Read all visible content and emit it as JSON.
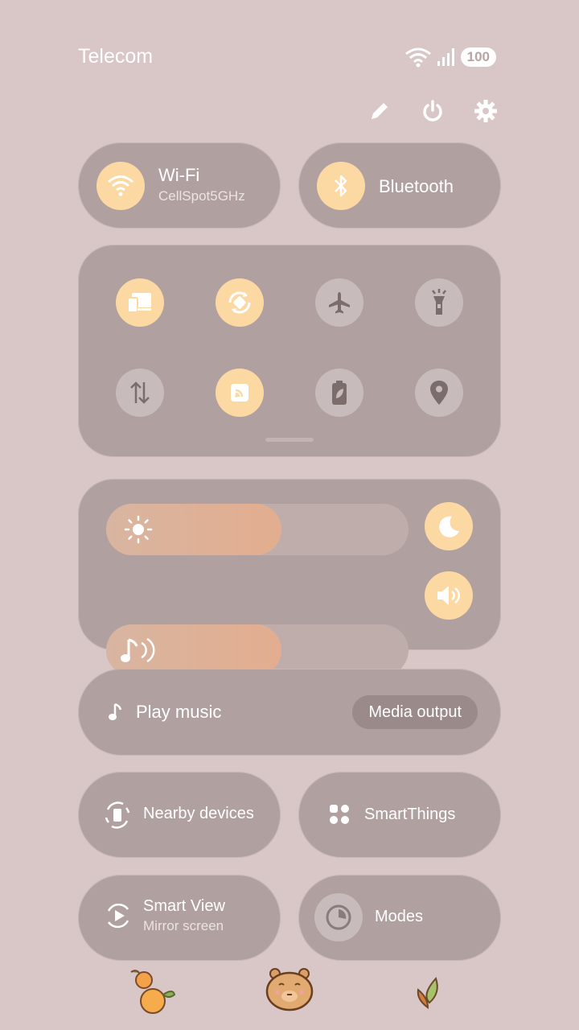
{
  "status": {
    "carrier": "Telecom",
    "battery": "100"
  },
  "wifi": {
    "label": "Wi-Fi",
    "network": "CellSpot5GHz"
  },
  "bluetooth": {
    "label": "Bluetooth"
  },
  "quick_toggles": [
    {
      "name": "screen-cast",
      "on": true
    },
    {
      "name": "auto-rotate",
      "on": true
    },
    {
      "name": "airplane-mode",
      "on": false
    },
    {
      "name": "flashlight",
      "on": false
    },
    {
      "name": "mobile-data",
      "on": false
    },
    {
      "name": "wireless-share",
      "on": true
    },
    {
      "name": "power-saving",
      "on": false
    },
    {
      "name": "location",
      "on": false
    }
  ],
  "sliders": {
    "brightness_level": 0.58,
    "volume_level": 0.58
  },
  "media": {
    "play_label": "Play music",
    "output_label": "Media output"
  },
  "tiles": {
    "nearby": "Nearby devices",
    "smartthings": "SmartThings",
    "smartview": "Smart View",
    "smartview_sub": "Mirror screen",
    "modes": "Modes"
  },
  "colors": {
    "accent": "#fcd9a3",
    "panel": "#b0a09f",
    "background": "#d9c6c6"
  }
}
